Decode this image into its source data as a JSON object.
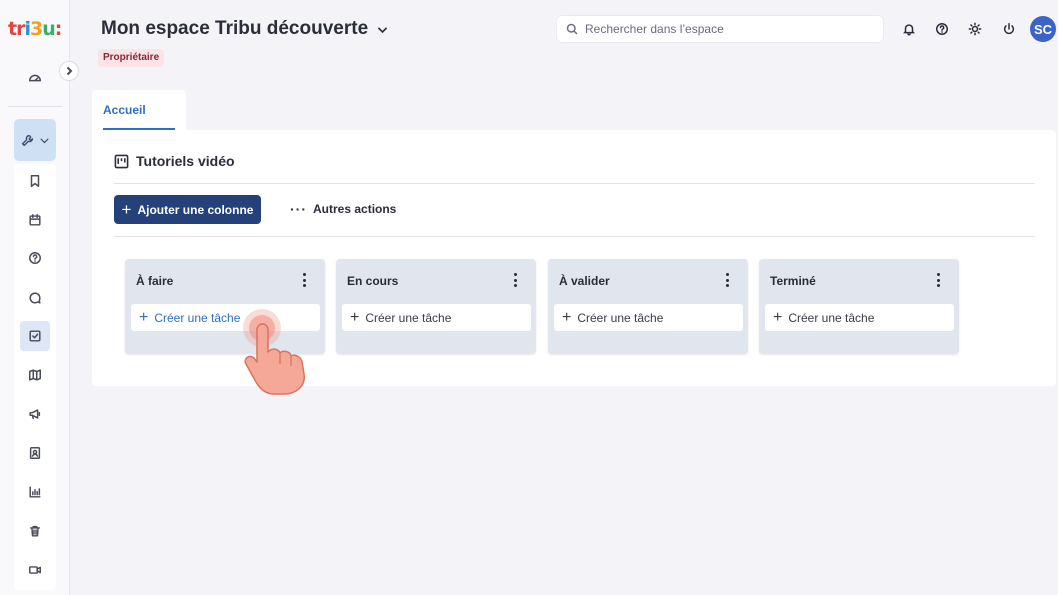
{
  "app": {
    "logo": "tri3u:"
  },
  "header": {
    "title": "Mon espace Tribu découverte",
    "role_badge": "Propriétaire",
    "search_placeholder": "Rechercher dans l’espace",
    "avatar_initials": "SC"
  },
  "tabs": [
    {
      "label": "Accueil",
      "active": true
    }
  ],
  "board": {
    "title": "Tutoriels vidéo",
    "add_column_label": "Ajouter une colonne",
    "more_actions_label": "Autres actions",
    "columns": [
      {
        "title": "À faire",
        "create_label": "Créer une tâche"
      },
      {
        "title": "En cours",
        "create_label": "Créer une tâche"
      },
      {
        "title": "À valider",
        "create_label": "Créer une tâche"
      },
      {
        "title": "Terminé",
        "create_label": "Créer une tâche"
      }
    ]
  },
  "sidebar": {
    "items": [
      "dashboard-icon",
      "tools-icon",
      "bookmark-icon",
      "calendar-icon",
      "help-icon",
      "chat-icon",
      "tasks-icon",
      "map-icon",
      "megaphone-icon",
      "contacts-icon",
      "stats-icon",
      "trash-icon",
      "video-icon"
    ]
  },
  "colors": {
    "primary": "#24417a",
    "accent": "#2e6fc0",
    "badge_bg": "#fbe3e6",
    "avatar": "#3a64c8"
  }
}
